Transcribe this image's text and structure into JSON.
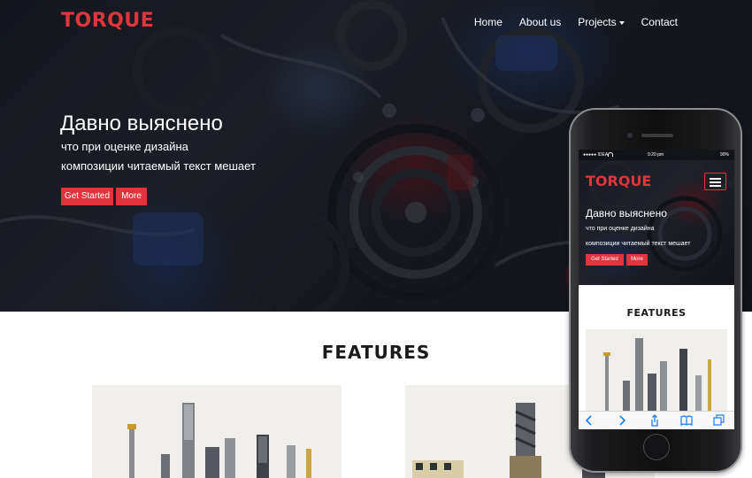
{
  "site": {
    "logo": "TORQUE",
    "nav": [
      {
        "label": "Home"
      },
      {
        "label": "About us"
      },
      {
        "label": "Projects"
      },
      {
        "label": "Contact"
      }
    ],
    "hero": {
      "title": "Давно выяснено",
      "line1": "что при оценке дизайна",
      "line2": "композиции читаемый текст мешает",
      "primary_button": "Get Started",
      "secondary_button": "More"
    },
    "features_heading": "FEATURES"
  },
  "mobile": {
    "status": {
      "carrier": "●●●●● IDEA",
      "time": "9:20 pm",
      "battery": "90%"
    },
    "logo": "TORQUE",
    "hero_title": "Давно выяснено",
    "hero_line1": "что при оценке дизайна",
    "hero_line2": "композиции читаемый текст мешает",
    "primary_button": "Get Started",
    "secondary_button": "More",
    "features_heading": "FEATURES",
    "toolbar_icons": [
      "back-icon",
      "forward-icon",
      "share-icon",
      "bookmarks-icon",
      "tabs-icon"
    ]
  },
  "colors": {
    "accent": "#e0353c",
    "hero_dark": "#1a1d26",
    "text_dark": "#1a1a1a",
    "ios_blue": "#1a7cf5"
  }
}
